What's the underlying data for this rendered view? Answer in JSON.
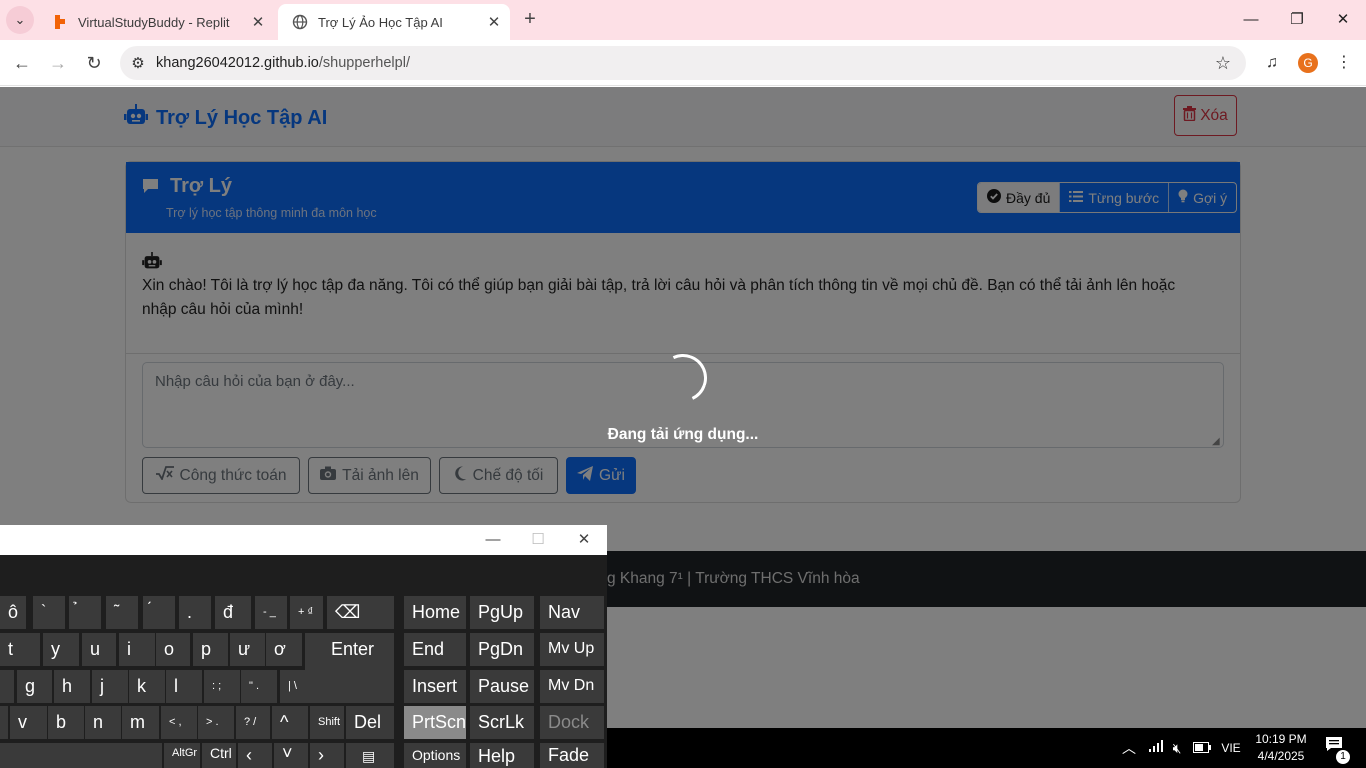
{
  "browser": {
    "tabs": [
      {
        "title": "VirtualStudyBuddy - Replit",
        "active": false
      },
      {
        "title": "Trợ Lý Ảo Học Tập AI",
        "active": true
      }
    ],
    "url_host": "khang26042012.github.io",
    "url_path": "/shupperhelpl/",
    "profile_initial": "G"
  },
  "app": {
    "brand": "Trợ Lý Học Tập AI",
    "clear_label": "Xóa",
    "card": {
      "title": "Trợ Lý",
      "subtitle": "Trợ lý học tập thông minh đa môn học",
      "modes": [
        {
          "icon": "check-circle-icon",
          "label": "Đầy đủ",
          "selected": true
        },
        {
          "icon": "list-ordered-icon",
          "label": "Từng bước",
          "selected": false
        },
        {
          "icon": "lightbulb-icon",
          "label": "Gợi ý",
          "selected": false
        }
      ]
    },
    "welcome_message": "Xin chào! Tôi là trợ lý học tập đa năng. Tôi có thể giúp bạn giải bài tập, trả lời câu hỏi và phân tích thông tin về mọi chủ đề. Bạn có thể tải ảnh lên hoặc nhập câu hỏi của mình!",
    "input_placeholder": "Nhập câu hỏi của bạn ở đây...",
    "buttons": {
      "formula": "Công thức toán",
      "upload": "Tải ảnh lên",
      "dark_mode": "Chế độ tối",
      "send": "Gửi"
    },
    "footer": "g Khang 7¹ | Trường THCS Vĩnh hòa",
    "loading_text": "Đang tải ứng dụng..."
  },
  "taskbar": {
    "language": "VIE",
    "time": "10:19 PM",
    "date": "4/4/2025",
    "notification_count": "1"
  },
  "keyboard": {
    "row1": [
      "ô",
      "`",
      "̉",
      "̃",
      "́",
      ".",
      "đ",
      "- _",
      "+ ₫"
    ],
    "row2": [
      "t",
      "y",
      "u",
      "i",
      "o",
      "p",
      "ư",
      "ơ"
    ],
    "row3": [
      "g",
      "h",
      "j",
      "k",
      "l",
      ": ;",
      "\" .",
      "| \\"
    ],
    "row4": [
      "v",
      "b",
      "n",
      "m",
      "< ,",
      "> .",
      "? /"
    ],
    "row5": [
      "AltGr",
      "Ctrl"
    ],
    "enter": "Enter",
    "shift": "Shift",
    "del": "Del",
    "nav": [
      [
        "Home",
        "PgUp",
        "Nav"
      ],
      [
        "End",
        "PgDn",
        "Mv Up"
      ],
      [
        "Insert",
        "Pause",
        "Mv Dn"
      ],
      [
        "PrtScn",
        "ScrLk",
        "Dock"
      ],
      [
        "Options",
        "Help",
        "Fade"
      ]
    ]
  }
}
